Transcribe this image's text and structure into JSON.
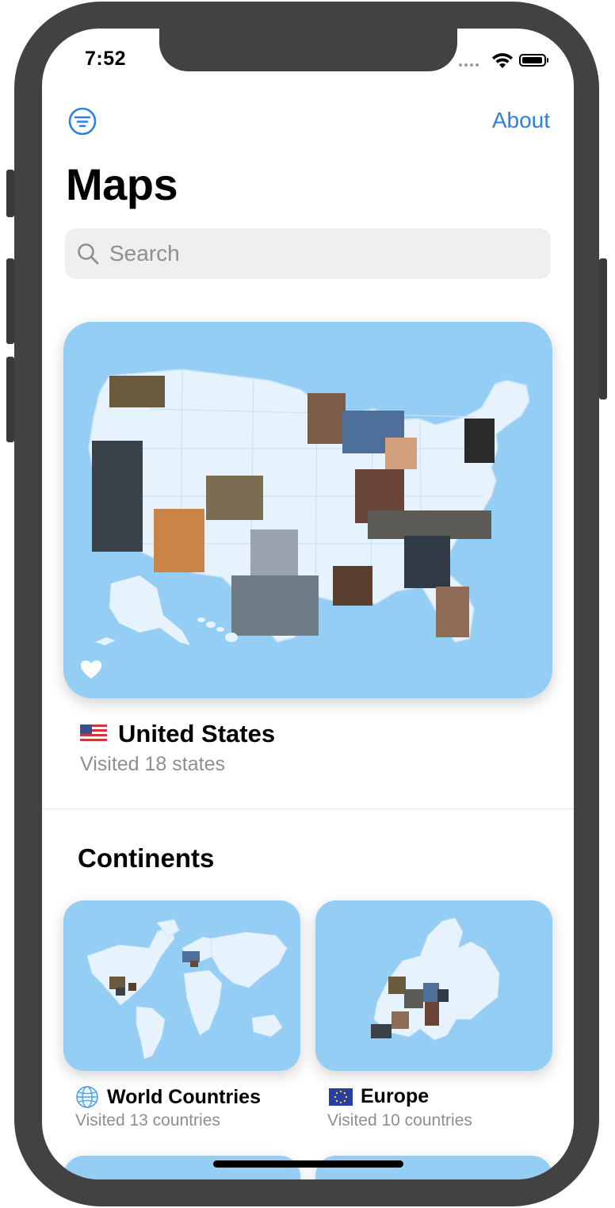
{
  "status_bar": {
    "time": "7:52"
  },
  "nav": {
    "about_label": "About",
    "filter_icon": "filter-circle-icon"
  },
  "page": {
    "title": "Maps"
  },
  "search": {
    "placeholder": "Search"
  },
  "featured_map": {
    "flag": "🇺🇸",
    "name": "United States",
    "subtitle": "Visited 18 states"
  },
  "continents": {
    "section_title": "Continents",
    "items": [
      {
        "icon": "globe-icon",
        "name": "World Countries",
        "subtitle": "Visited 13 countries"
      },
      {
        "icon": "eu-flag-icon",
        "name": "Europe",
        "subtitle": "Visited 10 countries"
      }
    ]
  },
  "colors": {
    "accent": "#2d7fe0",
    "map_background": "#95cef4",
    "land_unvisited": "#e6f3fd",
    "secondary_text": "#8e8e93"
  }
}
